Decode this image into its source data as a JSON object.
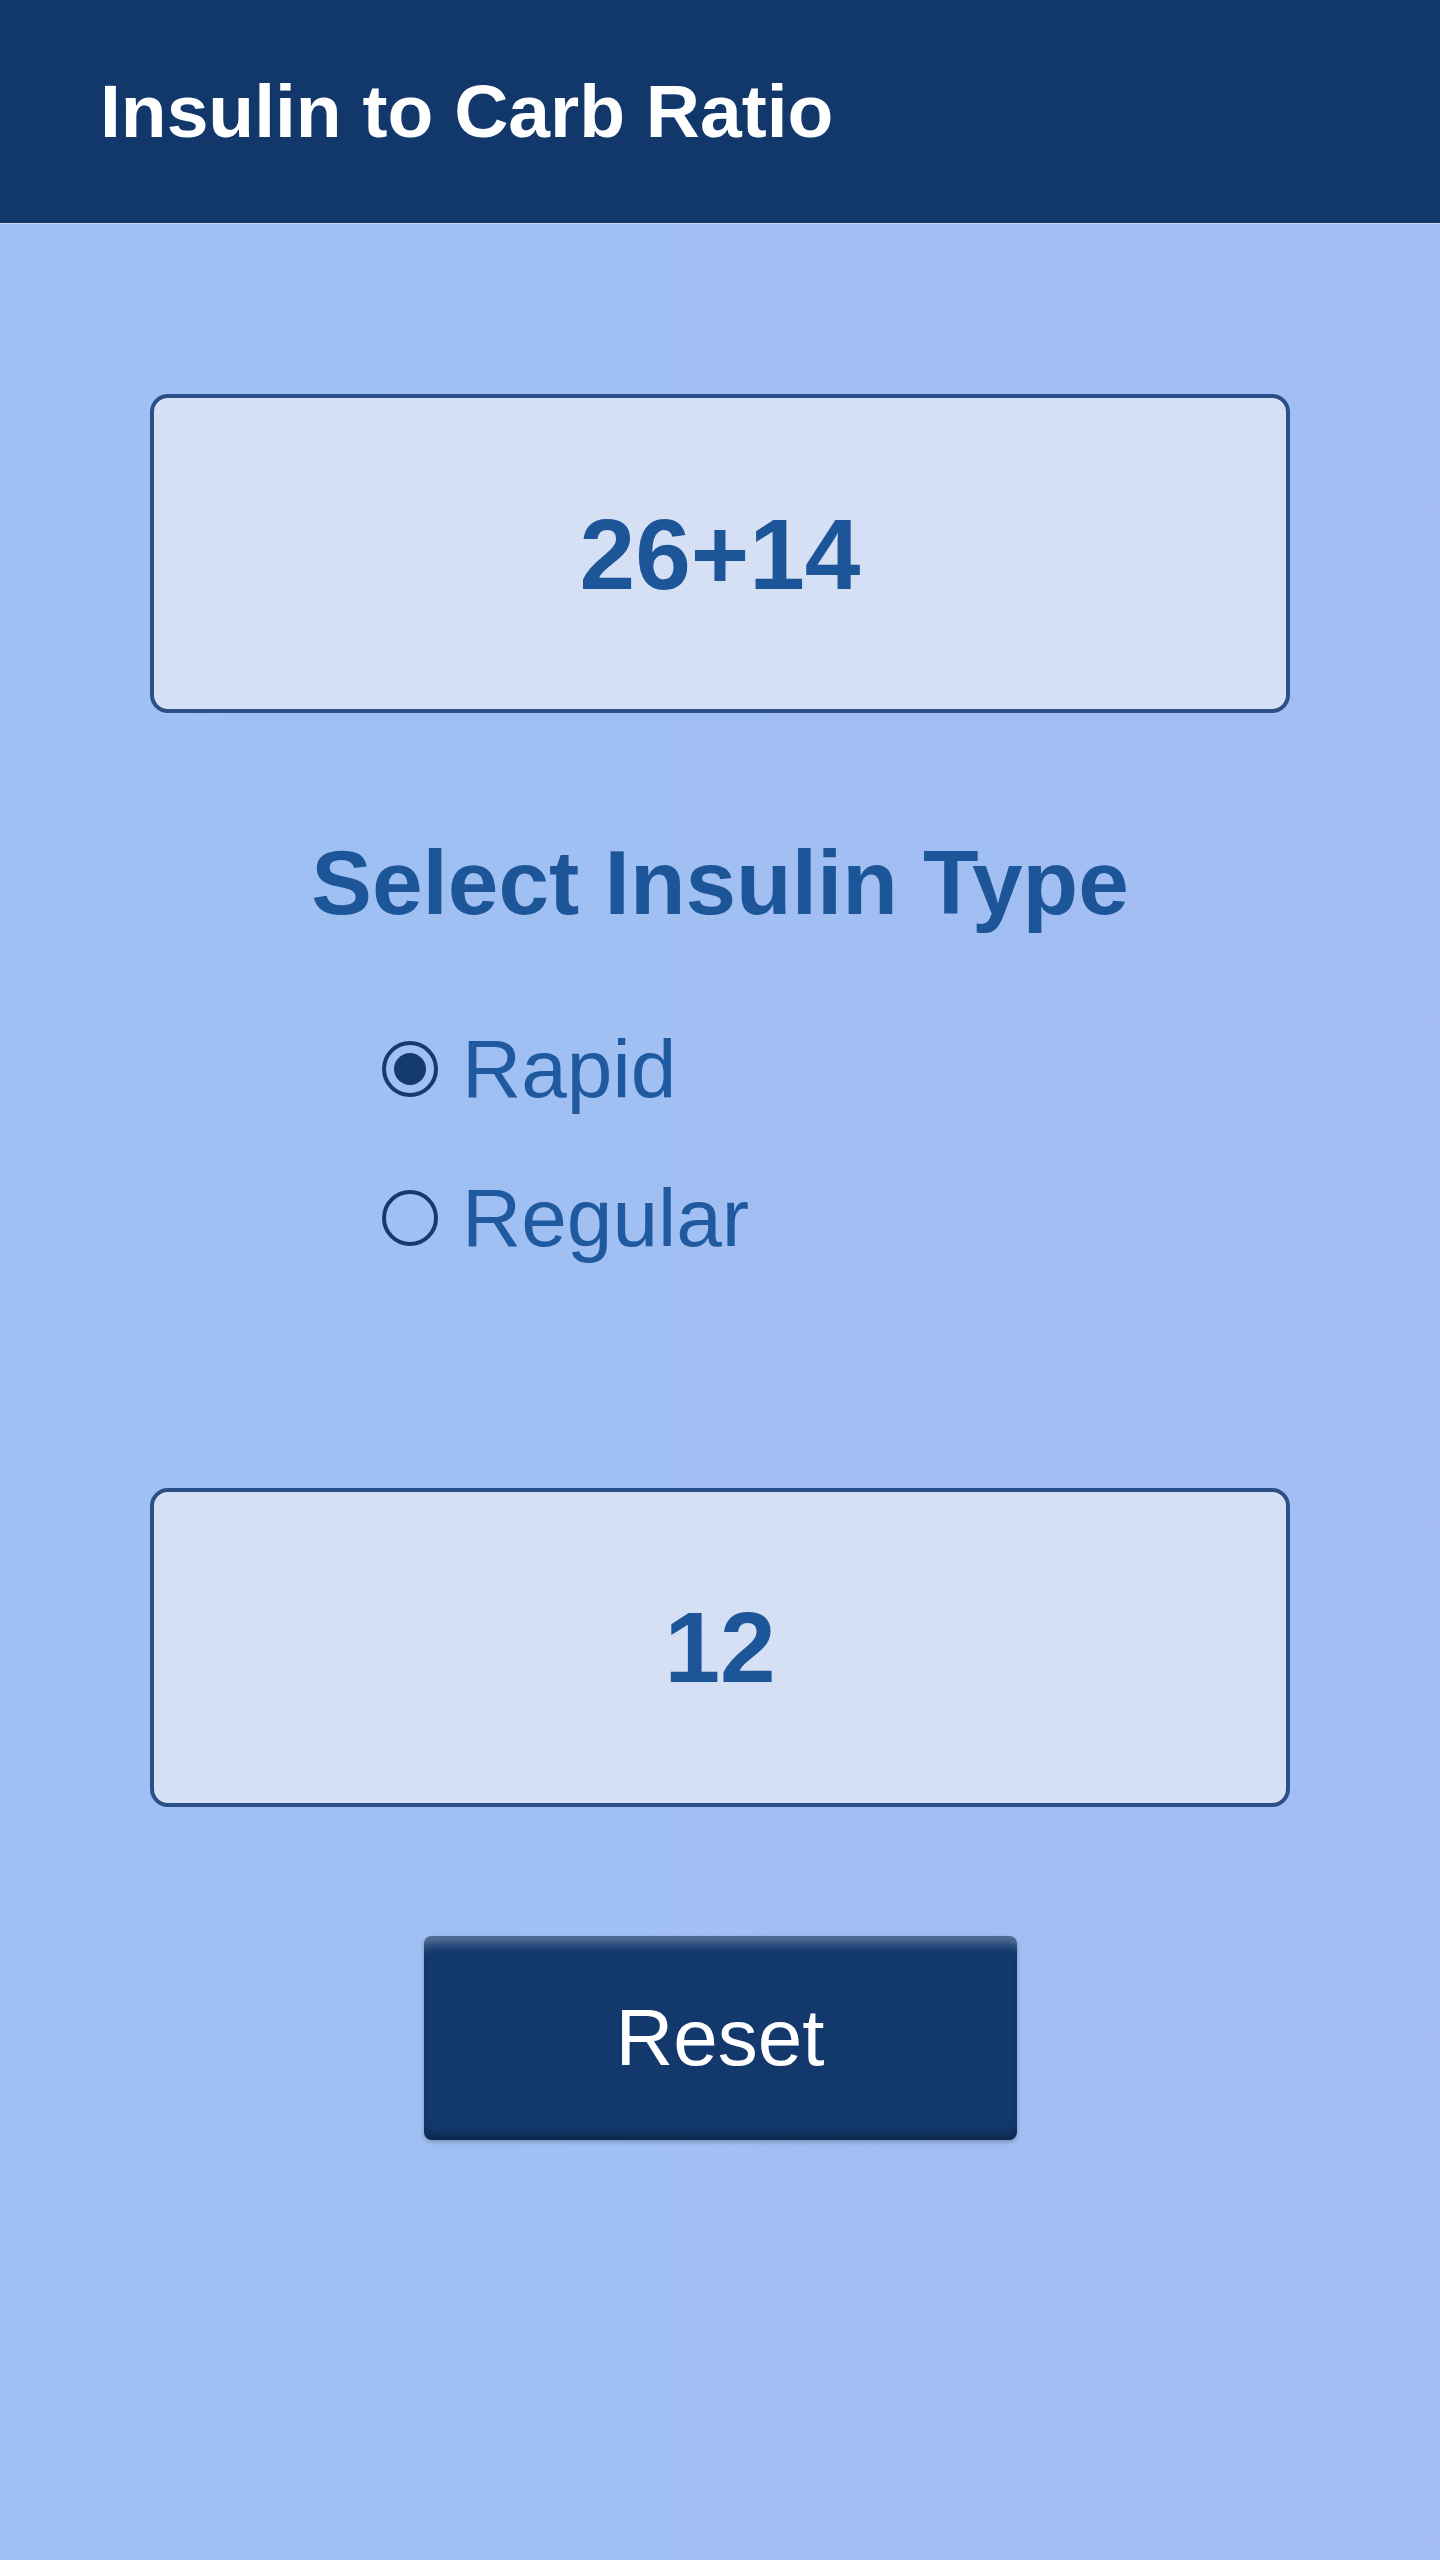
{
  "header": {
    "title": "Insulin to Carb Ratio"
  },
  "expression_display": {
    "value": "26+14"
  },
  "insulin_type": {
    "heading": "Select Insulin Type",
    "options": [
      {
        "label": "Rapid",
        "selected": true
      },
      {
        "label": "Regular",
        "selected": false
      }
    ]
  },
  "result_display": {
    "value": "12"
  },
  "buttons": [
    {
      "label": "Reset"
    }
  ]
}
